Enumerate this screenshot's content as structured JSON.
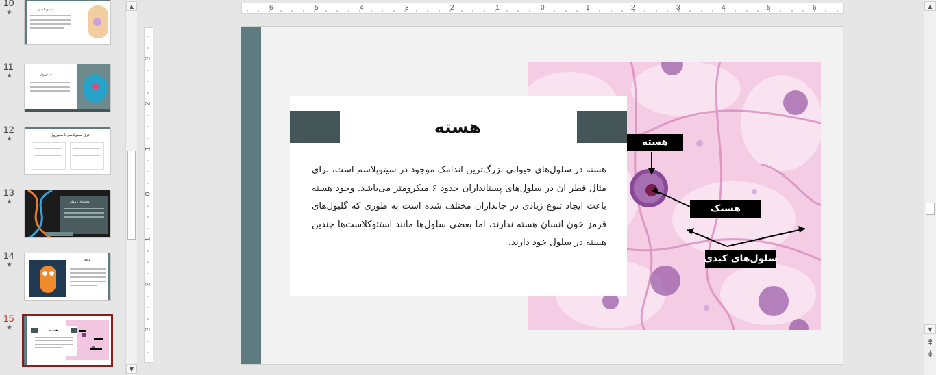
{
  "thumbnails": [
    {
      "number": "10",
      "star": "★",
      "title": "سیتوپلاسم"
    },
    {
      "number": "11",
      "star": "★",
      "title": "سیتوزول"
    },
    {
      "number": "12",
      "star": "★",
      "title": "فرق سیتوپلاسم با سیتوزول"
    },
    {
      "number": "13",
      "star": "★",
      "title": "محتوای ژنتیکی"
    },
    {
      "number": "14",
      "star": "★",
      "title": "RNA"
    },
    {
      "number": "15",
      "star": "★",
      "title": "هسته"
    }
  ],
  "active_slide": "15",
  "ruler": {
    "horizontal": [
      "6",
      "5",
      "4",
      "3",
      "2",
      "1",
      "0",
      "1",
      "2",
      "3",
      "4",
      "5",
      "6"
    ],
    "vertical": [
      "3",
      "2",
      "1",
      "0",
      "1",
      "2",
      "3"
    ]
  },
  "slide": {
    "title": "هسته",
    "body": "هسته در سلول‌های حیوانی بزرگ‌ترین اندامک موجود در سیتوپلاسم است، برای مثال قطر آن در سلول‌های پستانداران حدود ۶ میکرومتر می‌باشد. وجود هسته باعث ایجاد تنوع زیادی در جانداران مختلف شده است به طوری که گلبول‌های قرمز خون انسان هسته ندارند، اما بعضی سلول‌ها مانند استئوکلاست‌ها چندین هسته در سلول خود دارند.",
    "labels": {
      "nucleus": "هسته",
      "nucleolus": "هستک",
      "liver_cells": "سلول‌های کبدی"
    },
    "colors": {
      "accent_dark": "#445658",
      "side_band": "#5e7c80",
      "tissue_pink": "#f2c6e0",
      "nucleus_purple": "#7a3b86"
    }
  },
  "icons": {
    "scroll_up": "▲",
    "scroll_down": "▼",
    "prev_slide": "⇞",
    "next_slide": "⇟"
  }
}
